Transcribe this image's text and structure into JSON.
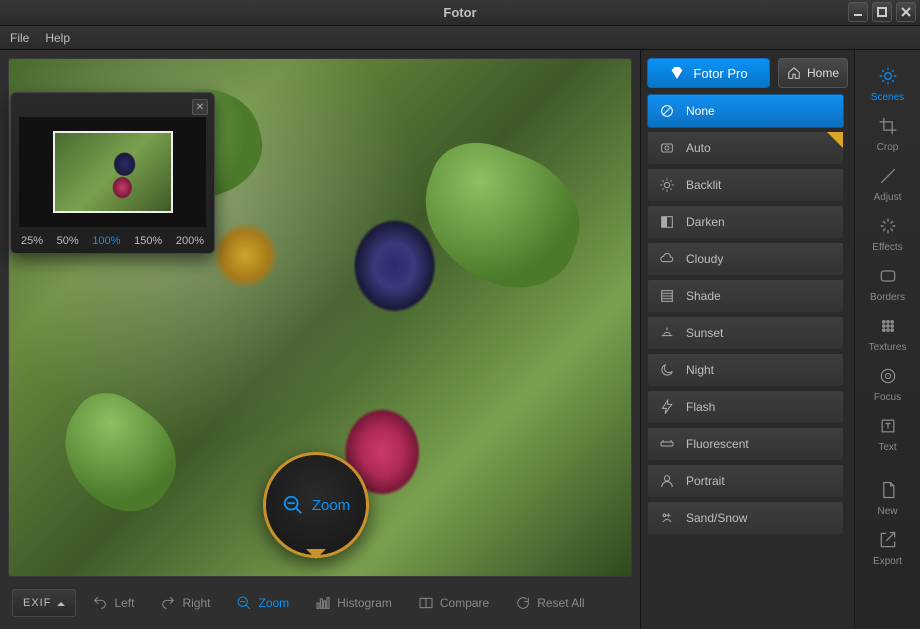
{
  "app_title": "Fotor",
  "menu": {
    "file": "File",
    "help": "Help"
  },
  "navigator": {
    "zoom_levels": [
      "25%",
      "50%",
      "100%",
      "150%",
      "200%"
    ],
    "active_zoom": "100%"
  },
  "zoom_callout": {
    "label": "Zoom"
  },
  "bottom_toolbar": {
    "exif": "EXIF",
    "items": [
      {
        "id": "rotate-left",
        "label": "Left"
      },
      {
        "id": "rotate-right",
        "label": "Right"
      },
      {
        "id": "zoom",
        "label": "Zoom",
        "active": true
      },
      {
        "id": "histogram",
        "label": "Histogram"
      },
      {
        "id": "compare",
        "label": "Compare"
      },
      {
        "id": "reset-all",
        "label": "Reset All"
      }
    ]
  },
  "right_panel": {
    "pro_label": "Fotor Pro",
    "home_label": "Home",
    "scenes": [
      {
        "id": "none",
        "label": "None",
        "active": true
      },
      {
        "id": "auto",
        "label": "Auto",
        "pro": true
      },
      {
        "id": "backlit",
        "label": "Backlit"
      },
      {
        "id": "darken",
        "label": "Darken"
      },
      {
        "id": "cloudy",
        "label": "Cloudy"
      },
      {
        "id": "shade",
        "label": "Shade"
      },
      {
        "id": "sunset",
        "label": "Sunset"
      },
      {
        "id": "night",
        "label": "Night"
      },
      {
        "id": "flash",
        "label": "Flash"
      },
      {
        "id": "fluorescent",
        "label": "Fluorescent"
      },
      {
        "id": "portrait",
        "label": "Portrait"
      },
      {
        "id": "sandsnow",
        "label": "Sand/Snow"
      }
    ]
  },
  "tool_rail": [
    {
      "id": "scenes",
      "label": "Scenes",
      "active": true
    },
    {
      "id": "crop",
      "label": "Crop"
    },
    {
      "id": "adjust",
      "label": "Adjust"
    },
    {
      "id": "effects",
      "label": "Effects"
    },
    {
      "id": "borders",
      "label": "Borders"
    },
    {
      "id": "textures",
      "label": "Textures"
    },
    {
      "id": "focus",
      "label": "Focus"
    },
    {
      "id": "text",
      "label": "Text"
    },
    {
      "id": "new",
      "label": "New"
    },
    {
      "id": "export",
      "label": "Export"
    }
  ]
}
